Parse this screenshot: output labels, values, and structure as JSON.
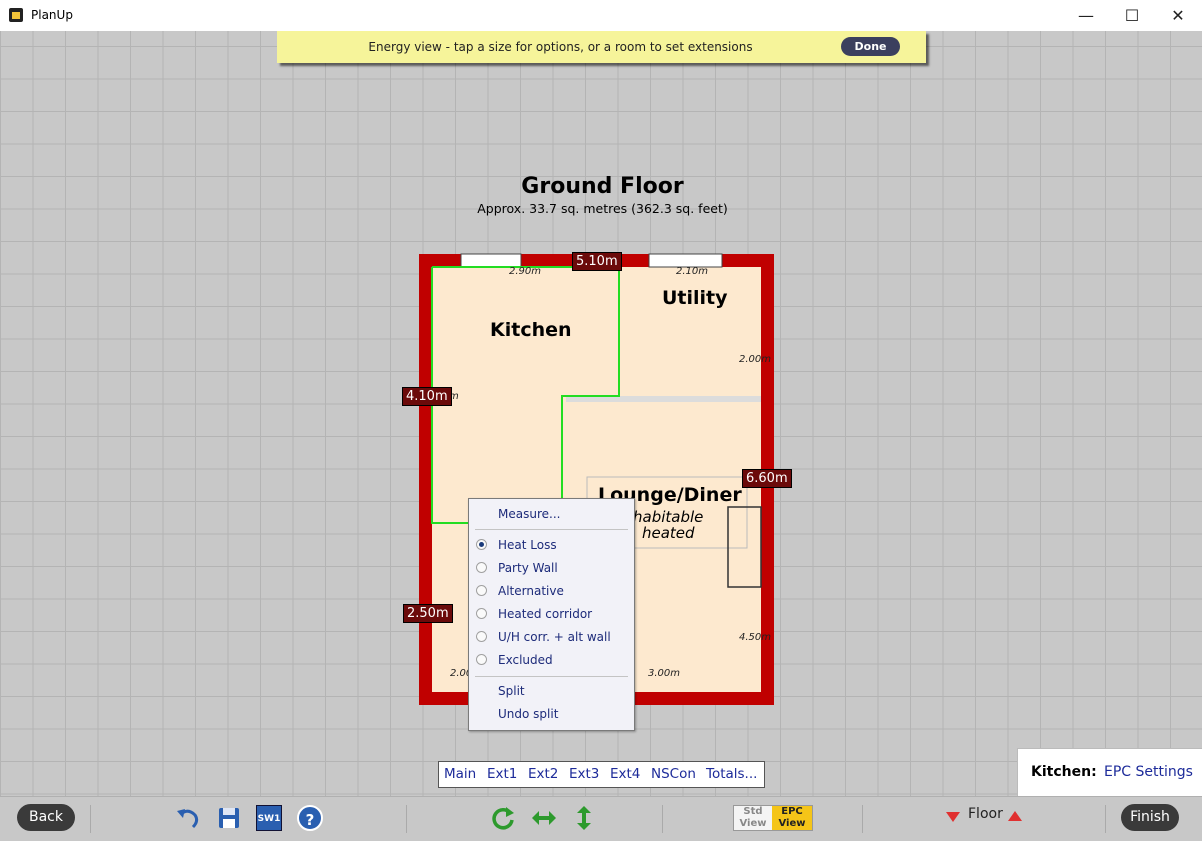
{
  "window": {
    "title": "PlanUp",
    "minimize": "—",
    "maximize": "☐",
    "close": "✕"
  },
  "banner": {
    "text": "Energy view - tap a size for options, or a room to set extensions",
    "done_label": "Done"
  },
  "floor": {
    "title": "Ground Floor",
    "subtitle": "Approx. 33.7 sq. metres (362.3 sq. feet)"
  },
  "rooms": {
    "kitchen": "Kitchen",
    "utility": "Utility",
    "lounge": "Lounge/Diner",
    "lounge_sub1": "habitable",
    "lounge_sub2": "heated"
  },
  "dims": {
    "top": "5.10m",
    "left_upper": "4.10m",
    "right": "6.60m",
    "left_lower": "2.50m",
    "kitchen_w": "2.90m",
    "utility_w": "2.10m",
    "utility_h": "2.00m",
    "lounge_h": "4.50m",
    "bottom_right": "3.00m",
    "bottom_left": "2.00",
    "left_suffix": "m"
  },
  "popup": {
    "measure": "Measure...",
    "options": [
      {
        "label": "Heat Loss",
        "selected": true
      },
      {
        "label": "Party Wall",
        "selected": false
      },
      {
        "label": "Alternative",
        "selected": false
      },
      {
        "label": "Heated corridor",
        "selected": false
      },
      {
        "label": "U/H corr. + alt wall",
        "selected": false
      },
      {
        "label": "Excluded",
        "selected": false
      }
    ],
    "split": "Split",
    "undo_split": "Undo split"
  },
  "tabs": [
    "Main",
    "Ext1",
    "Ext2",
    "Ext3",
    "Ext4",
    "NSCon",
    "Totals..."
  ],
  "kitchen_panel": {
    "label": "Kitchen:",
    "link": "EPC Settings"
  },
  "toolbar": {
    "back": "Back",
    "finish": "Finish",
    "sw_label": "SW1",
    "help": "?",
    "std_view_1": "Std",
    "std_view_2": "View",
    "epc_view_1": "EPC",
    "epc_view_2": "View",
    "floor_label": "Floor"
  },
  "colors": {
    "wall": "#c00000",
    "room_fill": "#fde9cf",
    "selected_room": "#22dd22",
    "banner": "#f6f49a",
    "dim_label": "#6b0a0a"
  }
}
